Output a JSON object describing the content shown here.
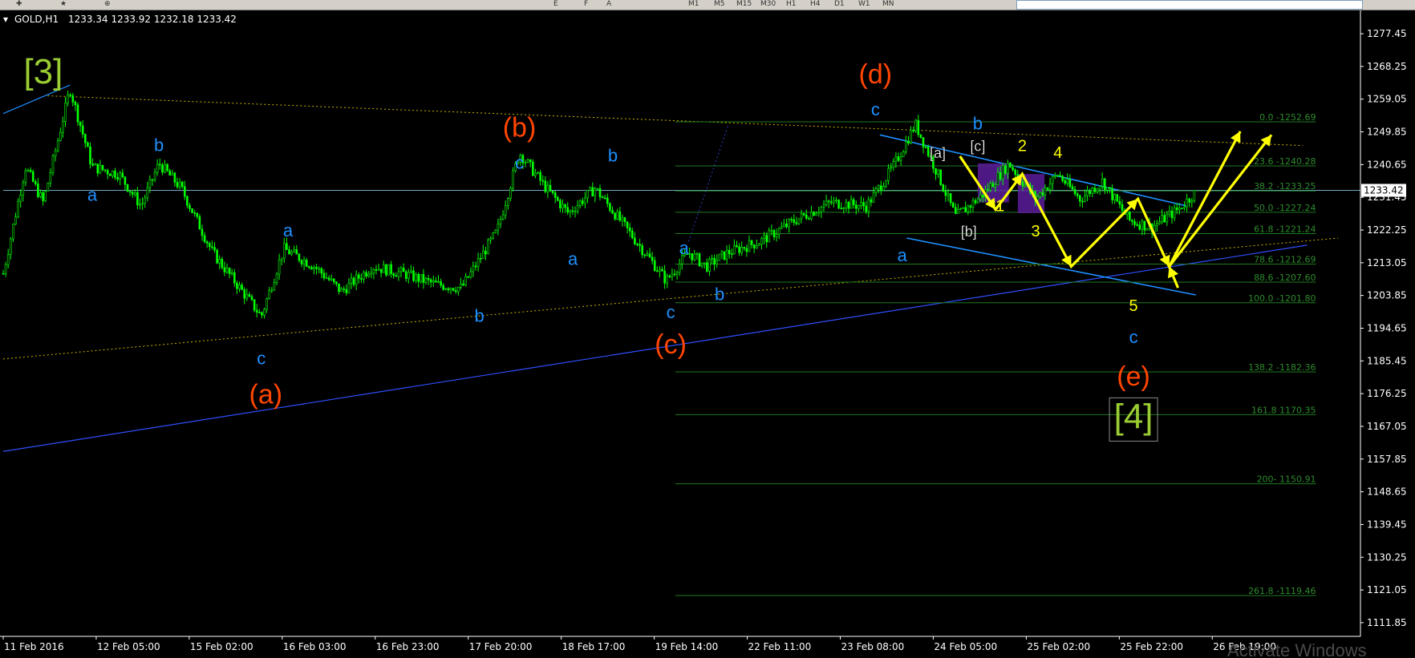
{
  "toolbar": {
    "timeframes": [
      "M1",
      "M5",
      "M15",
      "M30",
      "H1",
      "H4",
      "D1",
      "W1",
      "MN"
    ],
    "obj_e": "E",
    "obj_f": "F",
    "obj_a": "A"
  },
  "header": {
    "symbol": "GOLD,H1",
    "ohlc": "1233.34 1233.92 1232.18 1233.42"
  },
  "price_marker": "1233.42",
  "watermark": "Activate Windows",
  "colors": {
    "background": "#000000",
    "candle": "#00ff00",
    "wave_major": "#9acd32",
    "wave_orange": "#ff4500",
    "wave_cyan": "#1e90ff",
    "wave_yellow": "#ffff00",
    "trendline": "#2f4fff",
    "fib": "#1f7a1f",
    "channel": "#1e90ff",
    "rect": "#5a1c9a"
  },
  "chart_data": {
    "type": "candlestick",
    "symbol": "GOLD",
    "timeframe": "H1",
    "grid": false,
    "yaxis_ticks": [
      "1277.45",
      "1268.25",
      "1259.05",
      "1249.85",
      "1240.65",
      "1231.45",
      "1222.25",
      "1213.05",
      "1203.85",
      "1194.65",
      "1185.45",
      "1176.25",
      "1167.05",
      "1157.85",
      "1148.65",
      "1139.45",
      "1130.25",
      "1121.05",
      "1111.85"
    ],
    "xaxis_ticks": [
      "11 Feb 2016",
      "12 Feb 05:00",
      "15 Feb 02:00",
      "16 Feb 03:00",
      "16 Feb 23:00",
      "17 Feb 20:00",
      "18 Feb 17:00",
      "19 Feb 14:00",
      "22 Feb 11:00",
      "23 Feb 08:00",
      "24 Feb 05:00",
      "25 Feb 02:00",
      "25 Feb 22:00",
      "26 Feb 19:00"
    ],
    "ylim": [
      1108,
      1284
    ],
    "current_price": 1233.42,
    "price_path": [
      {
        "x": 0,
        "y": 1210
      },
      {
        "x": 0.5,
        "y": 1240
      },
      {
        "x": 0.9,
        "y": 1230
      },
      {
        "x": 1.5,
        "y": 1262
      },
      {
        "x": 2.0,
        "y": 1240
      },
      {
        "x": 2.6,
        "y": 1238
      },
      {
        "x": 3.1,
        "y": 1229
      },
      {
        "x": 3.5,
        "y": 1241
      },
      {
        "x": 4.0,
        "y": 1234
      },
      {
        "x": 4.7,
        "y": 1216
      },
      {
        "x": 5.8,
        "y": 1198
      },
      {
        "x": 6.3,
        "y": 1217
      },
      {
        "x": 7.0,
        "y": 1212
      },
      {
        "x": 7.6,
        "y": 1205
      },
      {
        "x": 8.3,
        "y": 1212
      },
      {
        "x": 9.0,
        "y": 1210
      },
      {
        "x": 9.7,
        "y": 1207
      },
      {
        "x": 10.3,
        "y": 1206
      },
      {
        "x": 11.1,
        "y": 1222
      },
      {
        "x": 11.6,
        "y": 1244
      },
      {
        "x": 12.2,
        "y": 1234
      },
      {
        "x": 12.7,
        "y": 1227
      },
      {
        "x": 13.3,
        "y": 1234
      },
      {
        "x": 13.8,
        "y": 1226
      },
      {
        "x": 14.6,
        "y": 1213
      },
      {
        "x": 14.9,
        "y": 1208
      },
      {
        "x": 15.4,
        "y": 1216
      },
      {
        "x": 15.8,
        "y": 1212
      },
      {
        "x": 16.3,
        "y": 1216
      },
      {
        "x": 17.0,
        "y": 1219
      },
      {
        "x": 17.8,
        "y": 1225
      },
      {
        "x": 18.6,
        "y": 1230
      },
      {
        "x": 19.4,
        "y": 1229
      },
      {
        "x": 20.0,
        "y": 1240
      },
      {
        "x": 20.5,
        "y": 1252
      },
      {
        "x": 21.0,
        "y": 1238
      },
      {
        "x": 21.4,
        "y": 1226
      },
      {
        "x": 22.0,
        "y": 1232
      },
      {
        "x": 22.6,
        "y": 1241
      },
      {
        "x": 23.2,
        "y": 1231
      },
      {
        "x": 23.7,
        "y": 1238
      },
      {
        "x": 24.2,
        "y": 1231
      },
      {
        "x": 24.7,
        "y": 1236
      },
      {
        "x": 25.3,
        "y": 1225
      },
      {
        "x": 25.8,
        "y": 1223
      },
      {
        "x": 26.4,
        "y": 1228
      },
      {
        "x": 26.8,
        "y": 1233
      }
    ],
    "fibonacci": [
      {
        "label": "0.0 -1252.69",
        "y": 1252.69
      },
      {
        "label": "23.6 -1240.28",
        "y": 1240.28
      },
      {
        "label": "38.2 -1233.25",
        "y": 1233.25
      },
      {
        "label": "50.0 -1227.24",
        "y": 1227.24
      },
      {
        "label": "61.8 -1221.24",
        "y": 1221.24
      },
      {
        "label": "78.6 -1212.69",
        "y": 1212.69
      },
      {
        "label": "88.6 -1207.60",
        "y": 1207.6
      },
      {
        "label": "100.0 -1201.80",
        "y": 1201.8
      },
      {
        "label": "138.2 -1182.36",
        "y": 1182.36
      },
      {
        "label": "161.8 1170.35",
        "y": 1170.35
      },
      {
        "label": "200- 1150.91",
        "y": 1150.91
      },
      {
        "label": "261.8 -1119.46",
        "y": 1119.46
      }
    ],
    "annotations": [
      {
        "text": "[3]",
        "color": "wave_major",
        "size": 44,
        "x": 0.9,
        "y": 1263.5
      },
      {
        "text": "a",
        "color": "wave_cyan",
        "size": 22,
        "x": 2.0,
        "y": 1230.5
      },
      {
        "text": "b",
        "color": "wave_cyan",
        "size": 22,
        "x": 3.5,
        "y": 1244.5
      },
      {
        "text": "a",
        "color": "wave_cyan",
        "size": 22,
        "x": 6.4,
        "y": 1220.5
      },
      {
        "text": "c",
        "color": "wave_cyan",
        "size": 22,
        "x": 5.8,
        "y": 1184.5
      },
      {
        "text": "(a)",
        "color": "wave_orange",
        "size": 34,
        "x": 5.9,
        "y": 1173.5
      },
      {
        "text": "b",
        "color": "wave_cyan",
        "size": 22,
        "x": 10.7,
        "y": 1196.5
      },
      {
        "text": "(b)",
        "color": "wave_orange",
        "size": 34,
        "x": 11.6,
        "y": 1248.5
      },
      {
        "text": "c",
        "color": "wave_cyan",
        "size": 22,
        "x": 11.6,
        "y": 1239.5
      },
      {
        "text": "a",
        "color": "wave_cyan",
        "size": 22,
        "x": 12.8,
        "y": 1212.5
      },
      {
        "text": "b",
        "color": "wave_cyan",
        "size": 22,
        "x": 13.7,
        "y": 1241.5
      },
      {
        "text": "c",
        "color": "wave_cyan",
        "size": 22,
        "x": 15.0,
        "y": 1197.5
      },
      {
        "text": "(c)",
        "color": "wave_orange",
        "size": 34,
        "x": 15.0,
        "y": 1187.5
      },
      {
        "text": "a",
        "color": "wave_cyan",
        "size": 22,
        "x": 15.3,
        "y": 1215.5
      },
      {
        "text": "b",
        "color": "wave_cyan",
        "size": 22,
        "x": 16.1,
        "y": 1202.5
      },
      {
        "text": "(d)",
        "color": "wave_orange",
        "size": 34,
        "x": 19.6,
        "y": 1263.5
      },
      {
        "text": "c",
        "color": "wave_cyan",
        "size": 22,
        "x": 19.6,
        "y": 1254.5
      },
      {
        "text": "a",
        "color": "wave_cyan",
        "size": 22,
        "x": 20.2,
        "y": 1213.5
      },
      {
        "text": "b",
        "color": "wave_cyan",
        "size": 22,
        "x": 21.9,
        "y": 1250.5
      },
      {
        "text": "[a]",
        "color": "#ffffff",
        "size": 18,
        "x": 21.0,
        "y": 1242.5
      },
      {
        "text": "[c]",
        "color": "#ffffff",
        "size": 18,
        "x": 21.9,
        "y": 1244.5
      },
      {
        "text": "[b]",
        "color": "#ffffff",
        "size": 18,
        "x": 21.7,
        "y": 1220.5
      },
      {
        "text": "1",
        "color": "wave_yellow",
        "size": 20,
        "x": 22.4,
        "y": 1227.5
      },
      {
        "text": "2",
        "color": "wave_yellow",
        "size": 20,
        "x": 22.9,
        "y": 1244.5
      },
      {
        "text": "3",
        "color": "wave_yellow",
        "size": 20,
        "x": 23.2,
        "y": 1220.5
      },
      {
        "text": "4",
        "color": "wave_yellow",
        "size": 20,
        "x": 23.7,
        "y": 1242.5
      },
      {
        "text": "5",
        "color": "wave_yellow",
        "size": 20,
        "x": 25.4,
        "y": 1199.5
      },
      {
        "text": "c",
        "color": "wave_cyan",
        "size": 22,
        "x": 25.4,
        "y": 1190.5
      },
      {
        "text": "(e)",
        "color": "wave_orange",
        "size": 34,
        "x": 25.4,
        "y": 1178.5
      },
      {
        "text": "[4]",
        "color": "wave_major",
        "size": 44,
        "x": 25.4,
        "y": 1166.5
      }
    ],
    "projection_path": [
      {
        "x": 21.5,
        "y": 1243
      },
      {
        "x": 22.3,
        "y": 1228
      },
      {
        "x": 22.9,
        "y": 1238
      },
      {
        "x": 24.0,
        "y": 1212
      },
      {
        "x": 25.5,
        "y": 1231
      },
      {
        "x": 26.2,
        "y": 1212
      },
      {
        "x": 27.8,
        "y": 1250
      }
    ],
    "projection_branch": [
      {
        "x": 26.4,
        "y": 1206
      },
      {
        "x": 26.2,
        "y": 1212
      },
      {
        "x": 28.5,
        "y": 1249
      }
    ],
    "lines": [
      {
        "kind": "support",
        "x1": 0,
        "y1": 1160,
        "x2": 29.3,
        "y2": 1218
      },
      {
        "kind": "dotted-yellow-lower",
        "x1": 0,
        "y1": 1186,
        "x2": 30.0,
        "y2": 1220
      },
      {
        "kind": "dotted-yellow-upper",
        "x1": 1.0,
        "y1": 1260,
        "x2": 29.2,
        "y2": 1246
      },
      {
        "kind": "channel-top",
        "x1": 19.7,
        "y1": 1249,
        "x2": 26.6,
        "y2": 1229
      },
      {
        "kind": "channel-bottom",
        "x1": 20.3,
        "y1": 1220,
        "x2": 26.8,
        "y2": 1204
      },
      {
        "kind": "dotted-blue",
        "x1": 15.4,
        "y1": 1219,
        "x2": 16.3,
        "y2": 1252
      }
    ],
    "rects": [
      {
        "x1": 21.9,
        "y1": 1241,
        "x2": 22.6,
        "y2": 1230
      },
      {
        "x1": 22.8,
        "y1": 1238,
        "x2": 23.4,
        "y2": 1227
      }
    ],
    "current_price_line": true
  }
}
